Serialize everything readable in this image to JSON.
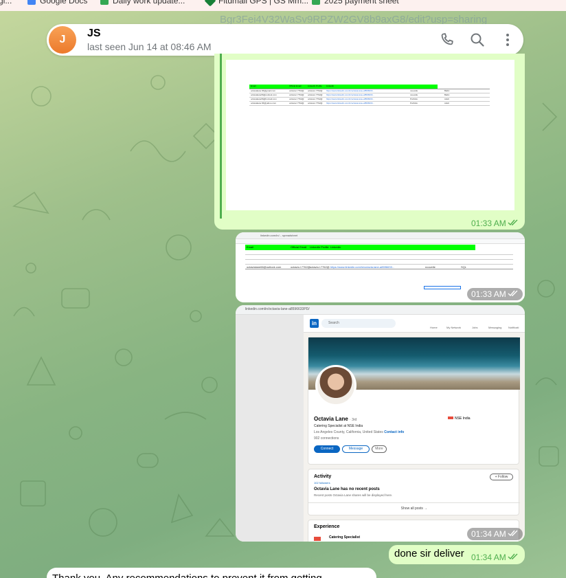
{
  "browser": {
    "bookmarks": [
      {
        "label": "gi...",
        "color": "#5f6368"
      },
      {
        "label": "Google Docs",
        "color": "#4285f4"
      },
      {
        "label": "Daily work update...",
        "color": "#34a853"
      },
      {
        "label": "Fitdmail GPS | GS Mm...",
        "color": "#188038"
      },
      {
        "label": "2025 payment sheet",
        "color": "#34a853"
      }
    ],
    "url_fragment": "Bgr3Fei4V32WaSv9RPZW2GV8b9axG8/edit?usp=sharing"
  },
  "chat": {
    "contact_initial": "J",
    "contact_name": "JS",
    "status": "last seen Jun 14 at 08:46 AM"
  },
  "messages": [
    {
      "type": "image",
      "desc": "spreadsheet-screenshot",
      "time": "01:33 AM",
      "read": true
    },
    {
      "type": "image",
      "desc": "spreadsheet-screenshot-2",
      "time": "01:33 AM",
      "read": true
    },
    {
      "type": "image",
      "desc": "linkedin-profile-screenshot",
      "time": "01:34 AM",
      "read": true
    },
    {
      "type": "text",
      "text": "done sir deliver",
      "time": "01:34 AM",
      "read": true
    },
    {
      "type": "text",
      "incoming": true,
      "text": "Thank you. Any recommendations to prevent it from getting"
    }
  ],
  "sheet1": {
    "headers": [
      "Email",
      "Official Email",
      "LinkedIn Profile",
      "Linkedin"
    ],
    "rows": [
      [
        "octavialane.66@gmail.com",
        "octavia.l.7762@",
        "octavia.l.7762@",
        "https://www.linkedin.com/in/octavia-lane-a8596633...",
        "nouvelle",
        "Baltic"
      ],
      [
        "octavialane66@outlook.com",
        "octavia.l.7762@",
        "octavia.l.7762@",
        "https://www.linkedin.com/in/octavia-lane-a8596633...",
        "nouvelle",
        "Baltic"
      ],
      [
        "octavialane66@hotmail.com",
        "octavia.l.7762@",
        "octavia.l.7762@",
        "https://www.linkedin.com/in/octavia-lane-a8596633...",
        "Portfolio",
        "Adult"
      ],
      [
        "octavialane.66@yahoo.com",
        "octavia.l.7762@",
        "octavia.l.7762@",
        "https://www.linkedin.com/in/octavia-lane-a8596633...",
        "Portfolio",
        "Adult"
      ]
    ]
  },
  "sheet2": {
    "url": "linkedin.com/in/... spreadsheet",
    "headers": [
      "Email",
      "Official Email",
      "LinkedIn Profile",
      "Linkedin"
    ],
    "row": [
      "octavialane66@outlook.com",
      "octavia.l.7762@",
      "octavia.l.7762@",
      "https://www.linkedin.com/in/octavia-lane-a8596633...",
      "nouvelle",
      "SQL"
    ]
  },
  "linkedin": {
    "url": "linkedin.com/in/octavia-lane-a8596633PD/",
    "search_placeholder": "Search",
    "nav": [
      "Home",
      "My Network",
      "Jobs",
      "Messaging",
      "Notificati"
    ],
    "name": "Octavia Lane",
    "degree": "· 3rd",
    "headline": "Catering Specialist at NSE India",
    "location": "Los Angeles County, California, United States",
    "contact_info": "Contact info",
    "connections": "902 connections",
    "company": "NSE India",
    "buttons": {
      "connect": "Connect",
      "message": "Message",
      "more": "More"
    },
    "activity": {
      "title": "Activity",
      "followers": "102 followers",
      "follow": "+ Follow",
      "no_posts": "Octavia Lane has no recent posts",
      "desc": "Recent posts Octavia Lane shares will be displayed here.",
      "show_all": "Show all posts →"
    },
    "experience": {
      "title": "Experience",
      "item": "Catering Specialist"
    }
  },
  "colors": {
    "bubble_out": "#e1fec6",
    "time_green": "#4fae4e",
    "avatar": "#f28c38",
    "sheet_green": "#00ff00"
  }
}
